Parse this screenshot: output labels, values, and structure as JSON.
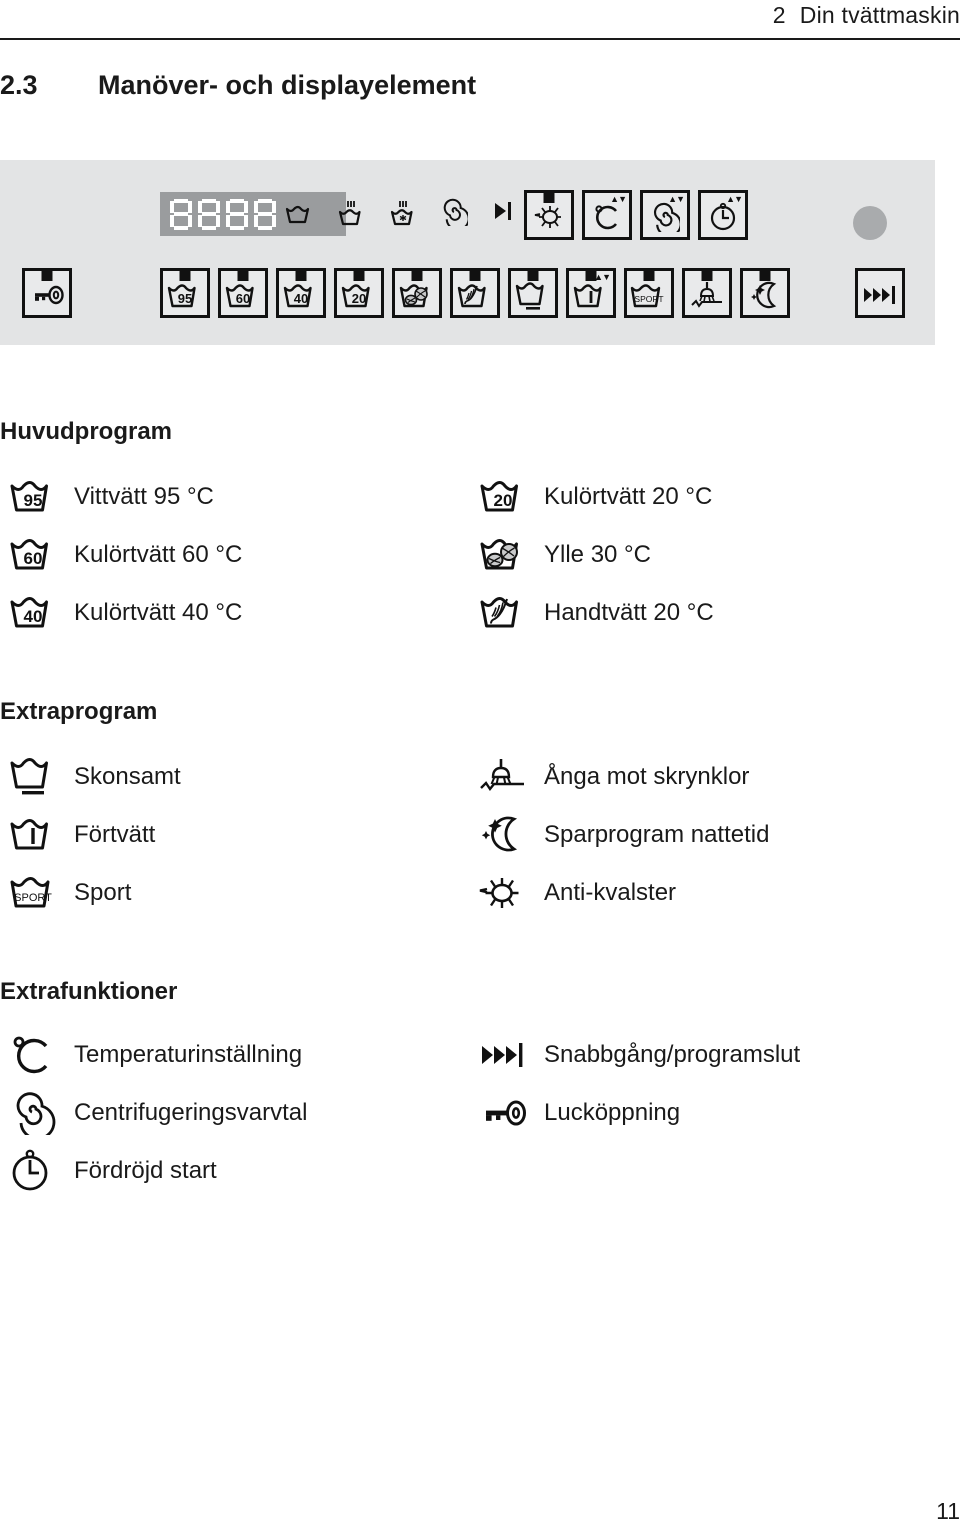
{
  "header": {
    "chapter_number": "2",
    "chapter_title": "Din tvättmaskin"
  },
  "section": {
    "number": "2.3",
    "title": "Manöver- och displayelement"
  },
  "panel": {
    "display_value": "8888",
    "status_icons": [
      "wash-tub-icon",
      "tub-heat-icon",
      "tub-heat-snowflake-icon",
      "spin-spiral-icon",
      "play-to-end-icon"
    ],
    "top_row_keys": [
      {
        "icon": "anti-mite-bug-icon",
        "led": true,
        "updown": false
      },
      {
        "icon": "temperature-celsius-icon",
        "led": false,
        "updown": true
      },
      {
        "icon": "spin-spiral-icon",
        "led": false,
        "updown": true
      },
      {
        "icon": "delay-clock-icon",
        "led": false,
        "updown": true
      }
    ],
    "bottom_row_keys": [
      {
        "icon": "tub-95-icon",
        "label": "95",
        "led": true,
        "updown": false
      },
      {
        "icon": "tub-60-icon",
        "label": "60",
        "led": true,
        "updown": false
      },
      {
        "icon": "tub-40-icon",
        "label": "40",
        "led": true,
        "updown": false
      },
      {
        "icon": "tub-20-icon",
        "label": "20",
        "led": true,
        "updown": false
      },
      {
        "icon": "tub-wool-icon",
        "label": "",
        "led": true,
        "updown": false
      },
      {
        "icon": "tub-hand-icon",
        "label": "",
        "led": true,
        "updown": false
      },
      {
        "icon": "tub-gentle-icon",
        "label": "",
        "led": true,
        "updown": false
      },
      {
        "icon": "tub-prewash-icon",
        "label": "",
        "led": true,
        "updown": true
      },
      {
        "icon": "tub-sport-icon",
        "label": "SPORT",
        "led": true,
        "updown": false
      },
      {
        "icon": "steam-icon",
        "label": "",
        "led": true,
        "updown": false
      },
      {
        "icon": "night-moon-icon",
        "label": "",
        "led": true,
        "updown": false
      }
    ],
    "door_key": {
      "icon": "door-key-icon",
      "led": true
    },
    "fast_forward_key": {
      "icon": "fast-forward-end-icon",
      "led": false
    },
    "start_knob": "start-knob"
  },
  "main_programs": {
    "heading": "Huvudprogram",
    "left": [
      {
        "icon": "tub-95-icon",
        "label": "Vittvätt 95 °C"
      },
      {
        "icon": "tub-60-icon",
        "label": "Kulörtvätt 60 °C"
      },
      {
        "icon": "tub-40-icon",
        "label": "Kulörtvätt 40 °C"
      }
    ],
    "right": [
      {
        "icon": "tub-20-icon",
        "label": "Kulörtvätt 20 °C"
      },
      {
        "icon": "tub-wool-icon",
        "label": "Ylle 30 °C"
      },
      {
        "icon": "tub-hand-icon",
        "label": "Handtvätt 20 °C"
      }
    ]
  },
  "extra_programs": {
    "heading": "Extraprogram",
    "left": [
      {
        "icon": "tub-gentle-icon",
        "label": "Skonsamt"
      },
      {
        "icon": "tub-prewash-icon",
        "label": "Förtvätt"
      },
      {
        "icon": "tub-sport-icon",
        "label": "Sport"
      }
    ],
    "right": [
      {
        "icon": "steam-icon",
        "label": "Ånga mot skrynklor"
      },
      {
        "icon": "night-moon-icon",
        "label": "Sparprogram nattetid"
      },
      {
        "icon": "anti-mite-bug-icon",
        "label": "Anti-kvalster"
      }
    ]
  },
  "extra_functions": {
    "heading": "Extrafunktioner",
    "left": [
      {
        "icon": "temperature-celsius-icon",
        "label": "Temperaturinställning"
      },
      {
        "icon": "spin-spiral-icon",
        "label": "Centrifugeringsvarvtal"
      },
      {
        "icon": "delay-clock-icon",
        "label": "Fördröjd start"
      }
    ],
    "right": [
      {
        "icon": "fast-forward-end-icon",
        "label": "Snabbgång/programslut"
      },
      {
        "icon": "door-key-icon",
        "label": "Lucköppning"
      }
    ]
  },
  "footer": {
    "page_number": "11"
  },
  "colors": {
    "panel_bg": "#e3e4e5",
    "display_bg": "#9a9c9e",
    "key_bg": "#e9eaeb",
    "ink": "#111111",
    "knob": "#a9abad"
  }
}
